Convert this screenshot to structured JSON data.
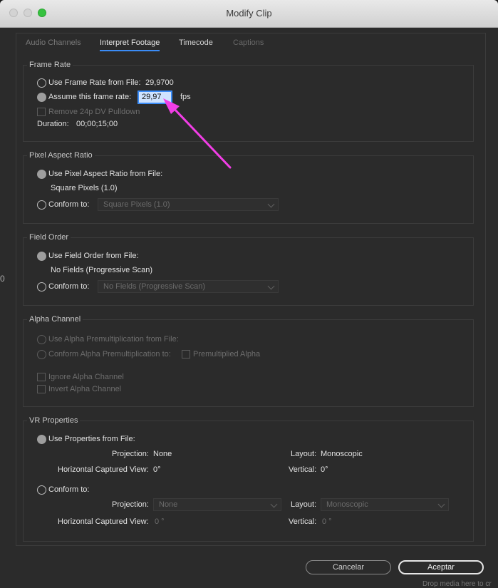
{
  "window": {
    "title": "Modify Clip"
  },
  "tabs": [
    {
      "label": "Audio Channels",
      "state": "inactive"
    },
    {
      "label": "Interpret Footage",
      "state": "active"
    },
    {
      "label": "Timecode",
      "state": "inactive"
    },
    {
      "label": "Captions",
      "state": "disabled"
    }
  ],
  "frame_rate": {
    "title": "Frame Rate",
    "use_file_label": "Use Frame Rate from File:",
    "use_file_value": "29,9700",
    "assume_label": "Assume this frame rate:",
    "assume_value": "29,97",
    "assume_unit": "fps",
    "pulldown_label": "Remove 24p DV Pulldown",
    "duration_label": "Duration:",
    "duration_value": "00;00;15;00"
  },
  "pixel_aspect": {
    "title": "Pixel Aspect Ratio",
    "use_file_label": "Use Pixel Aspect Ratio from File:",
    "file_value": "Square Pixels (1.0)",
    "conform_label": "Conform to:",
    "conform_value": "Square Pixels (1.0)"
  },
  "field_order": {
    "title": "Field Order",
    "use_file_label": "Use Field Order from File:",
    "file_value": "No Fields (Progressive Scan)",
    "conform_label": "Conform to:",
    "conform_value": "No Fields (Progressive Scan)"
  },
  "alpha": {
    "title": "Alpha Channel",
    "use_file_label": "Use Alpha Premultiplication from File:",
    "conform_label": "Conform Alpha Premultiplication to:",
    "premult_label": "Premultiplied Alpha",
    "ignore_label": "Ignore Alpha Channel",
    "invert_label": "Invert Alpha Channel"
  },
  "vr": {
    "title": "VR Properties",
    "use_file_label": "Use Properties from File:",
    "projection_label": "Projection:",
    "projection_value": "None",
    "layout_label": "Layout:",
    "layout_value": "Monoscopic",
    "hcv_label": "Horizontal Captured View:",
    "hcv_value": "0°",
    "vertical_label": "Vertical:",
    "vertical_value": "0°",
    "conform_label": "Conform to:",
    "conform_projection": "None",
    "conform_layout": "Monoscopic",
    "conform_hcv": "0 °",
    "conform_vertical": "0 °"
  },
  "buttons": {
    "cancel": "Cancelar",
    "ok": "Aceptar"
  },
  "background": {
    "left_glyph": "0",
    "bottom_right_text": "Drop media here to cr"
  },
  "annotation": {
    "arrow_color": "#f23ee6"
  },
  "colors": {
    "accent": "#3b8cf7",
    "panel": "#2b2b2b",
    "close_green": "#36c23f"
  }
}
